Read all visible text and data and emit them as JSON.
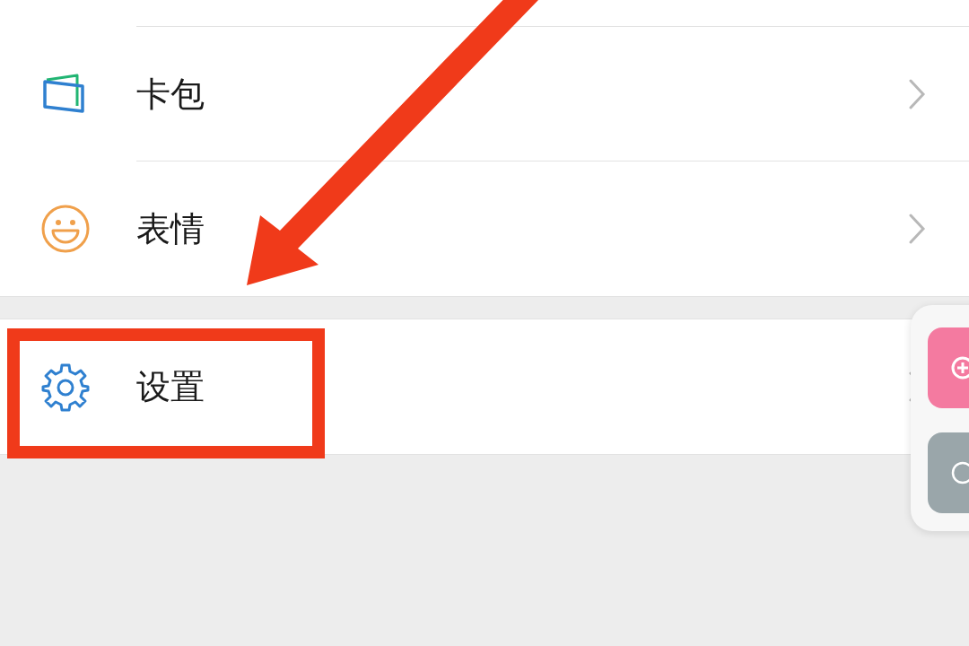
{
  "groups": [
    {
      "items": [
        {
          "kind": "wallet",
          "label": "卡包",
          "highlighted": false
        },
        {
          "kind": "emoji",
          "label": "表情",
          "highlighted": false
        }
      ]
    },
    {
      "items": [
        {
          "kind": "settings",
          "label": "设置",
          "highlighted": true
        }
      ]
    }
  ]
}
